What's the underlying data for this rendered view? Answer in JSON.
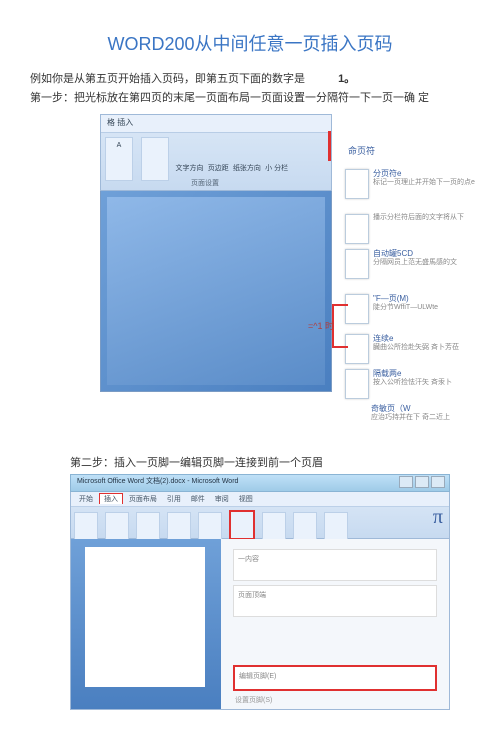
{
  "title": "WORD200从中间任意一页插入页码",
  "intro": {
    "line1_a": "例如你是从第五页开始插入页码，即第五页下面的数字是",
    "line1_b": "1。",
    "line2": "第一步：把光标放在第四页的末尾一页面布局一页面设置一分隔符一下一页一确 定"
  },
  "shot1": {
    "tab_label": "格 插入",
    "btn_text_dir": "文字方向",
    "btn_margin": "页边距",
    "btn_paper": "纸张方向",
    "btn_size": "小 分栏",
    "section_label": "页面设置",
    "side_title": "命页符",
    "callouts": [
      {
        "label": "分页符e",
        "desc": "标记一页理止并开始下一页的点e"
      },
      {
        "label": "",
        "desc": "播示分栏符后面的文字将从下"
      },
      {
        "label": "自动罐5CD",
        "desc": "分隔网员上范无盛馬感的文"
      },
      {
        "label": "\"F—页(M)",
        "desc": "陡分节WffiT—ULWte"
      },
      {
        "label": "连续e",
        "desc": "臓曲公所捡赴矢弼 斉卜芳莅"
      },
      {
        "label": "隔载两e",
        "desc": "按入公听捡怯汗矢 斉汞卜"
      },
      {
        "label": "奇敏页（W",
        "desc": "应治巧持并在下 奇二近上"
      }
    ],
    "eq_label": "=^1 时"
  },
  "step2_label": "第二步：插入一页脚一编辑页脚一连接到前一个页眉",
  "shot2": {
    "window_title": "Microsoft Office Word 文档(2).docx - Microsoft Word",
    "tabs": [
      "开始",
      "插入",
      "页面布局",
      "引用",
      "邮件",
      "审阅",
      "视图"
    ],
    "active_tab": "插入",
    "panel_text1": "一内容",
    "panel_text2": "页面顶端",
    "panel_red": "编辑页脚(E)",
    "panel_small": "设置页脚(S)"
  }
}
